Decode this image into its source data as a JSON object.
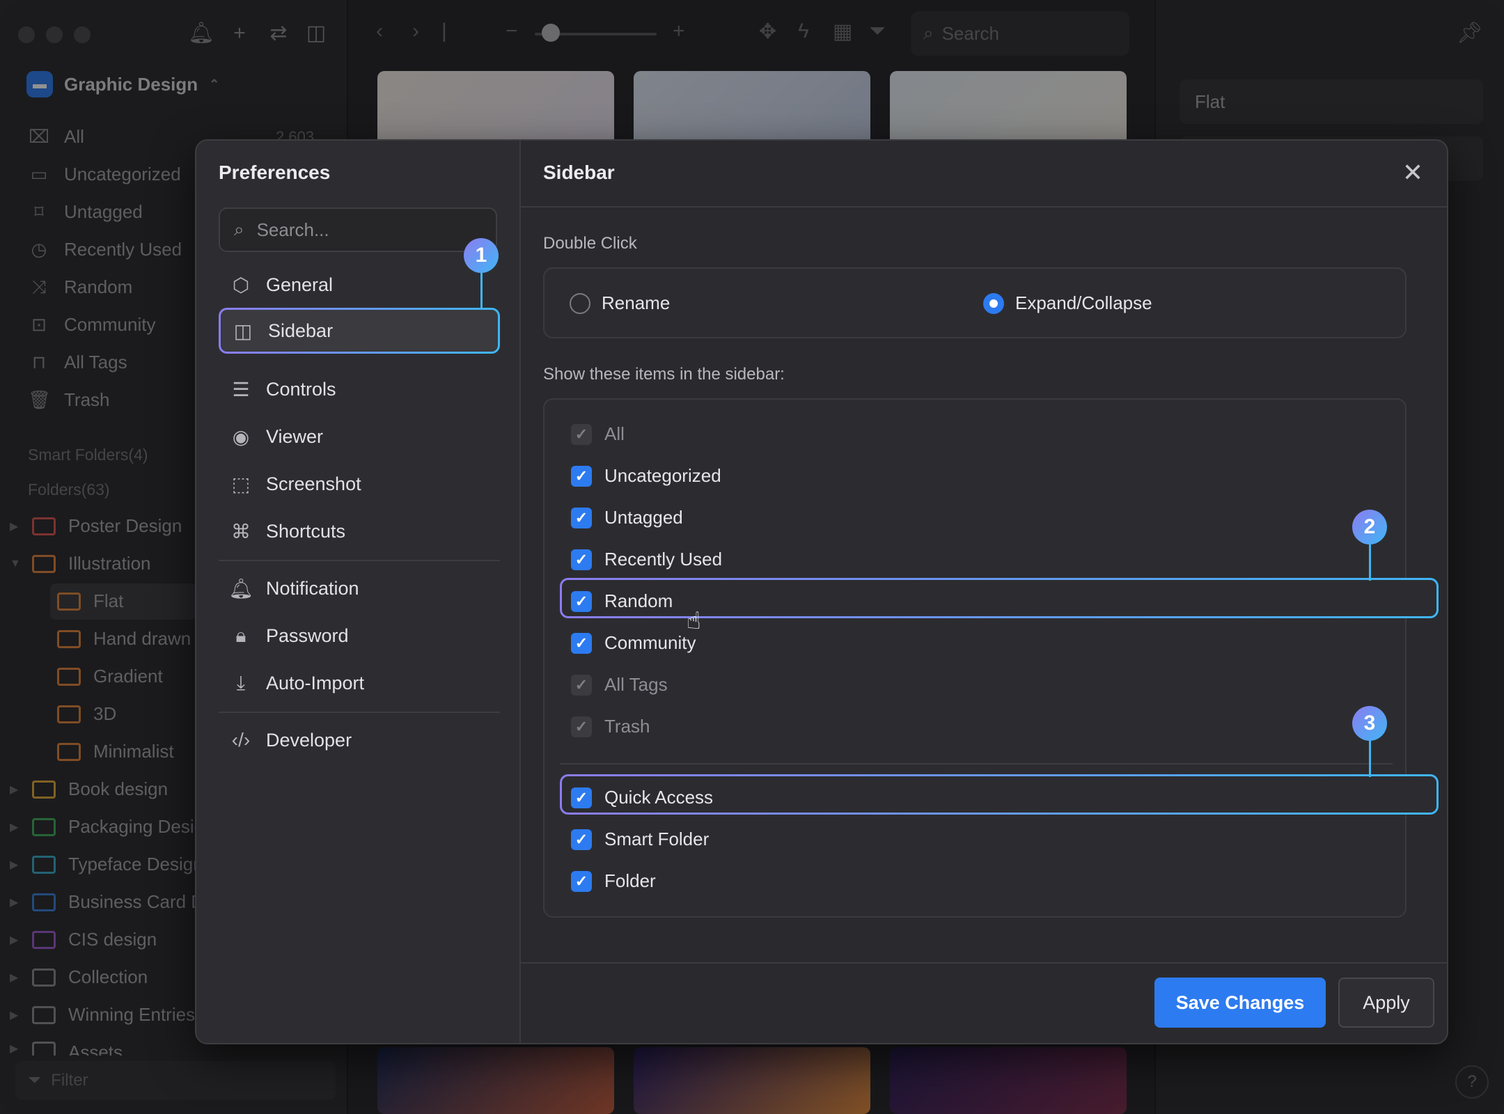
{
  "toolbar": {
    "search_placeholder": "Search"
  },
  "library": {
    "name": "Graphic Design",
    "switch_glyph": "⌃"
  },
  "sidebar": {
    "nav": [
      {
        "label": "All",
        "icon": "inbox-icon"
      },
      {
        "label": "Uncategorized",
        "icon": "folder-question-icon"
      },
      {
        "label": "Untagged",
        "icon": "tag-question-icon"
      },
      {
        "label": "Recently Used",
        "icon": "clock-icon"
      },
      {
        "label": "Random",
        "icon": "shuffle-icon"
      },
      {
        "label": "Community",
        "icon": "community-icon"
      },
      {
        "label": "All Tags",
        "icon": "bookmark-icon"
      },
      {
        "label": "Trash",
        "icon": "trash-icon"
      }
    ],
    "all_count": "2,603",
    "smart_folders": "Smart Folders(4)",
    "folders_header": "Folders(63)",
    "folders": [
      {
        "label": "Poster Design",
        "color": "#d9534f"
      },
      {
        "label": "Illustration",
        "color": "#e0823a"
      },
      {
        "label": "Flat",
        "color": "#e0823a"
      },
      {
        "label": "Hand drawn",
        "color": "#e0823a"
      },
      {
        "label": "Gradient",
        "color": "#e0823a"
      },
      {
        "label": "3D",
        "color": "#e0823a"
      },
      {
        "label": "Minimalist",
        "color": "#e0823a"
      },
      {
        "label": "Book design",
        "color": "#e0a93a"
      },
      {
        "label": "Packaging Design",
        "color": "#3fae5a"
      },
      {
        "label": "Typeface Design",
        "color": "#3aa9c9"
      },
      {
        "label": "Business Card Design",
        "color": "#3a7fd9"
      },
      {
        "label": "CIS design",
        "color": "#9b59d0"
      },
      {
        "label": "Collection",
        "color": "#8a8a90"
      },
      {
        "label": "Winning Entries",
        "color": "#8a8a90"
      },
      {
        "label": "Assets",
        "color": "#8a8a90"
      }
    ],
    "filter_placeholder": "Filter"
  },
  "inspector": {
    "name_value": "Flat"
  },
  "preferences": {
    "title": "Preferences",
    "search_placeholder": "Search...",
    "nav": [
      {
        "label": "General",
        "icon": "gear-icon"
      },
      {
        "label": "Sidebar",
        "icon": "sidebar-icon"
      },
      {
        "label": "Controls",
        "icon": "sliders-icon"
      },
      {
        "label": "Viewer",
        "icon": "eye-icon"
      },
      {
        "label": "Screenshot",
        "icon": "screenshot-icon"
      },
      {
        "label": "Shortcuts",
        "icon": "command-icon"
      },
      {
        "label": "Notification",
        "icon": "bell-icon"
      },
      {
        "label": "Password",
        "icon": "lock-icon"
      },
      {
        "label": "Auto-Import",
        "icon": "download-icon"
      },
      {
        "label": "Developer",
        "icon": "code-icon"
      }
    ],
    "selected": "Sidebar"
  },
  "panel": {
    "title": "Sidebar",
    "double_click_label": "Double Click",
    "rename_label": "Rename",
    "expand_label": "Expand/Collapse",
    "double_click_selected": "Expand/Collapse",
    "show_label": "Show these items in the sidebar:",
    "items": [
      {
        "label": "All",
        "checked": true,
        "disabled": true
      },
      {
        "label": "Uncategorized",
        "checked": true,
        "disabled": false
      },
      {
        "label": "Untagged",
        "checked": true,
        "disabled": false
      },
      {
        "label": "Recently Used",
        "checked": true,
        "disabled": false
      },
      {
        "label": "Random",
        "checked": true,
        "disabled": false
      },
      {
        "label": "Community",
        "checked": true,
        "disabled": false
      },
      {
        "label": "All Tags",
        "checked": true,
        "disabled": true
      },
      {
        "label": "Trash",
        "checked": true,
        "disabled": true
      }
    ],
    "items2": [
      {
        "label": "Quick Access",
        "checked": true
      },
      {
        "label": "Smart Folder",
        "checked": true
      },
      {
        "label": "Folder",
        "checked": true
      }
    ],
    "save_label": "Save Changes",
    "apply_label": "Apply"
  },
  "badges": [
    "1",
    "2",
    "3"
  ],
  "colors": {
    "accent": "#2d7bf0",
    "highlight_from": "#8c7cf0",
    "highlight_to": "#3fb6f5"
  }
}
